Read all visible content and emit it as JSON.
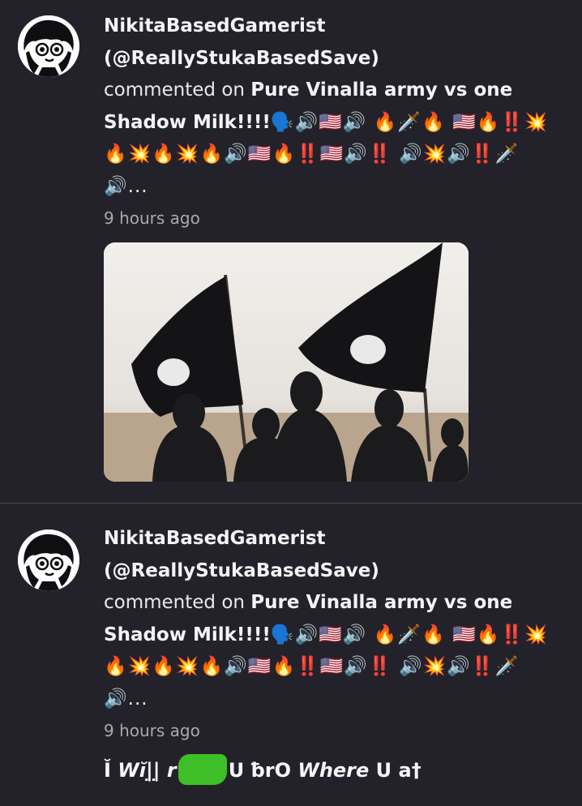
{
  "notifications": [
    {
      "display_name": "NikitaBasedGamerist",
      "handle": "(@ReallyStukaBasedSave)",
      "action": "commented on",
      "post_title": "Pure Vinalla army vs one Shadow Milk!!!!",
      "emoji_tail": "🗣️🔊🇺🇸🔊 🔥🗡️🔥 🇺🇸🔥‼️💥🔥💥🔥💥🔥🔊🇺🇸🔥‼️🇺🇸🔊‼️ 🔊💥🔊‼️🗡️🔊...",
      "timestamp": "9 hours ago",
      "thumbnail_icon": "image-thumbnail"
    },
    {
      "display_name": "NikitaBasedGamerist",
      "handle": "(@ReallyStukaBasedSave)",
      "action": "commented on",
      "post_title": "Pure Vinalla army vs one Shadow Milk!!!!",
      "emoji_tail": "🗣️🔊🇺🇸🔊 🔥🗡️🔥 🇺🇸🔥‼️💥🔥💥🔥💥🔥🔊🇺🇸🔥‼️🇺🇸🔊‼️ 🔊💥🔊‼️🗡️🔊...",
      "timestamp": "9 hours ago",
      "reply": {
        "part1": "Ĭ",
        "part2": "Wĭ|̣|̣ r",
        "part3": "U ƀrO",
        "part4": "Where",
        "part5": "U a†"
      }
    }
  ],
  "colors": {
    "background": "#23222a",
    "divider": "#4a4952",
    "text": "#f4f4f6",
    "muted": "#a9a8b0",
    "censor_blot": "#3fbf27"
  }
}
